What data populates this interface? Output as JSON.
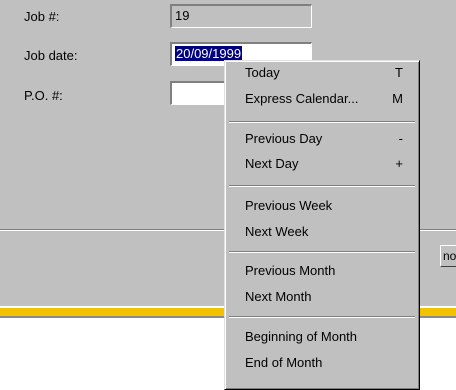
{
  "form": {
    "job_no": {
      "label": "Job #:",
      "value": "19"
    },
    "job_date": {
      "label": "Job date:",
      "value": "20/09/1999"
    },
    "po_no": {
      "label": "P.O. #:",
      "value": ""
    },
    "partial_button_label": "no"
  },
  "context_menu": {
    "groups": [
      [
        {
          "label": "Today",
          "accel": "T"
        },
        {
          "label": "Express Calendar...",
          "accel": "M"
        }
      ],
      [
        {
          "label": "Previous Day",
          "accel": "-"
        },
        {
          "label": "Next Day",
          "accel": "+"
        }
      ],
      [
        {
          "label": "Previous Week",
          "accel": ""
        },
        {
          "label": "Next Week",
          "accel": ""
        }
      ],
      [
        {
          "label": "Previous Month",
          "accel": ""
        },
        {
          "label": "Next Month",
          "accel": ""
        }
      ],
      [
        {
          "label": "Beginning of Month",
          "accel": ""
        },
        {
          "label": "End of Month",
          "accel": ""
        }
      ]
    ]
  },
  "colors": {
    "face": "#c0c0c0",
    "selection": "#000080",
    "gold_bar": "#f2c200"
  }
}
